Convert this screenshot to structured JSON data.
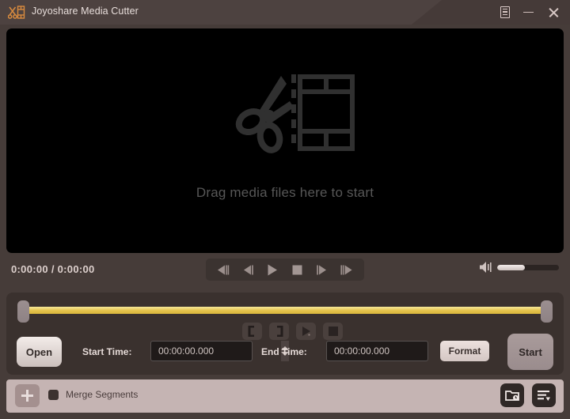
{
  "window": {
    "title": "Joyoshare Media Cutter",
    "logo_icon": "scissors-film-logo",
    "controls": {
      "menu_icon": "menu-list-icon",
      "minimize_icon": "minimize-icon",
      "close_icon": "close-icon"
    }
  },
  "preview": {
    "drop_text": "Drag media files here to start",
    "drop_icon": "scissors-filmstrip-icon",
    "background_color": "#000000"
  },
  "transport": {
    "time_display": "0:00:00 / 0:00:00",
    "buttons": [
      {
        "name": "previous-frame-button",
        "icon": "skip-backward-icon"
      },
      {
        "name": "rewind-button",
        "icon": "step-backward-icon"
      },
      {
        "name": "play-button",
        "icon": "play-icon"
      },
      {
        "name": "stop-button",
        "icon": "stop-icon"
      },
      {
        "name": "forward-button",
        "icon": "step-forward-icon"
      },
      {
        "name": "next-frame-button",
        "icon": "skip-forward-icon"
      }
    ],
    "volume": {
      "icon": "speaker-icon",
      "level_percent": 45
    }
  },
  "timeline": {
    "track_color": "#e4c24b",
    "left_handle": "trim-start-handle",
    "right_handle": "trim-end-handle",
    "trim_tools": [
      {
        "name": "set-start-point-button",
        "label": "["
      },
      {
        "name": "set-end-point-button",
        "label": "]"
      },
      {
        "name": "preview-segment-button",
        "icon": "play-preview-icon"
      },
      {
        "name": "stop-preview-button",
        "icon": "stop-icon"
      }
    ]
  },
  "controls": {
    "open_label": "Open",
    "start_time_label": "Start Time:",
    "start_time_value": "00:00:00.000",
    "end_time_label": "End Time:",
    "end_time_value": "00:00:00.000",
    "time_placeholder": "00:00:00.000",
    "format_label": "Format",
    "start_label": "Start"
  },
  "bottom": {
    "add_icon": "plus-icon",
    "merge_label": "Merge Segments",
    "merge_checked": false,
    "history_icon": "folder-clock-icon",
    "list_icon": "list-sort-icon"
  }
}
